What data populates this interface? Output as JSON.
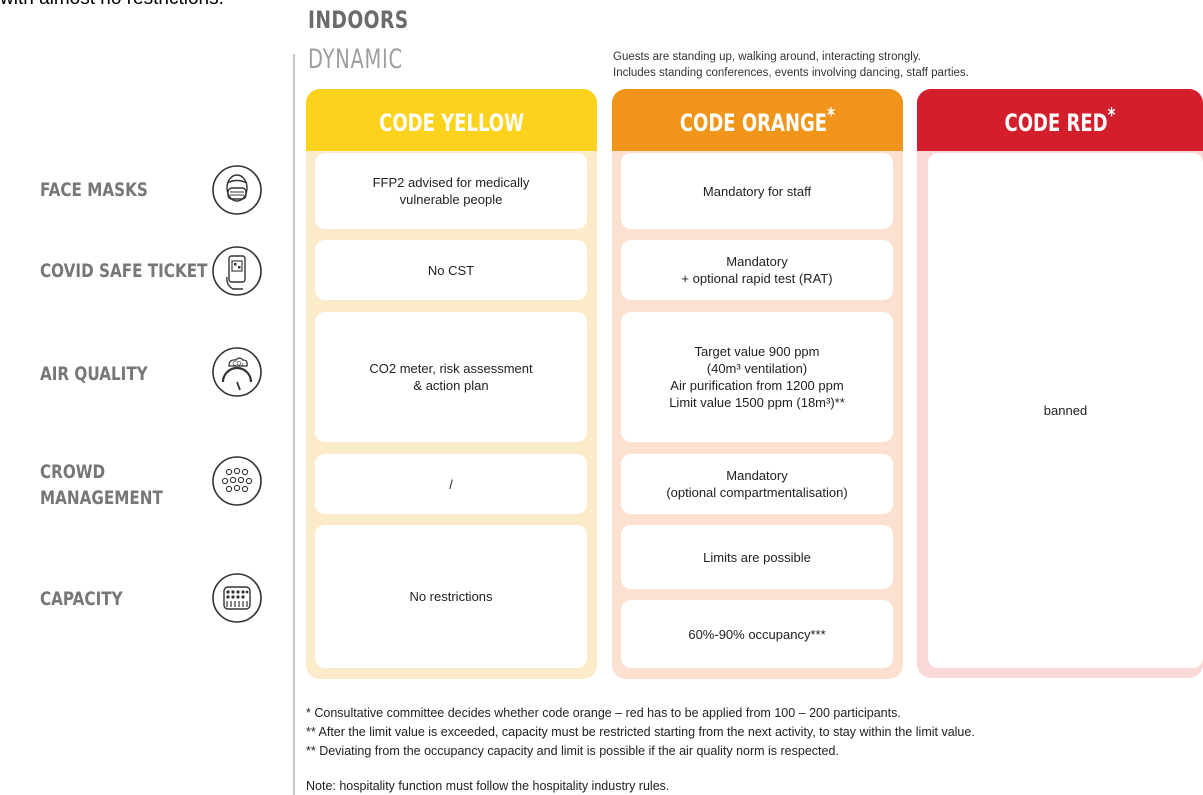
{
  "header_cut": "with almost no restrictions.",
  "title": {
    "line1": "INDOORS",
    "line2": "DYNAMIC"
  },
  "description": [
    "Guests are standing up, walking around, interacting strongly.",
    "Includes standing conferences, events involving dancing, staff parties."
  ],
  "columns": [
    {
      "label": "CODE YELLOW",
      "asterisk": "",
      "color": "#fcd21c"
    },
    {
      "label": "CODE ORANGE",
      "asterisk": "*",
      "color": "#f0941a"
    },
    {
      "label": "CODE RED",
      "asterisk": "*",
      "color": "#d31f2b"
    }
  ],
  "rows": [
    {
      "label_lines": [
        "FACE MASKS"
      ],
      "icon": "face-mask-icon"
    },
    {
      "label_lines": [
        "COVID SAFE TICKET"
      ],
      "icon": "phone-qr-icon"
    },
    {
      "label_lines": [
        "AIR QUALITY"
      ],
      "icon": "co2-gauge-icon"
    },
    {
      "label_lines": [
        "CROWD",
        "MANAGEMENT"
      ],
      "icon": "crowd-icon"
    },
    {
      "label_lines": [
        "CAPACITY"
      ],
      "icon": "capacity-icon"
    }
  ],
  "yellow_cells": [
    [
      "FFP2 advised for medically",
      "vulnerable people"
    ],
    [
      "No CST"
    ],
    [
      "CO2 meter, risk assessment",
      "& action plan"
    ],
    [
      "/"
    ],
    [
      "No restrictions"
    ]
  ],
  "orange_cells": [
    [
      "Mandatory for staff"
    ],
    [
      "Mandatory",
      "+ optional rapid test (RAT)"
    ],
    [
      "Target value 900 ppm",
      "(40m³ ventilation)",
      "Air purification from 1200 ppm",
      "Limit value 1500 ppm (18m³)**"
    ],
    [
      "Mandatory",
      "(optional compartmentalisation)"
    ],
    [
      "Limits are possible"
    ],
    [
      "60%-90% occupancy***"
    ]
  ],
  "red_cell": "banned",
  "footnotes": [
    "* Consultative committee decides whether code orange – red has to be applied from  100 – 200 participants.",
    "** After the limit value is exceeded, capacity must be restricted starting from the next activity, to stay within the limit value.",
    "** Deviating from the occupancy capacity and limit is possible if the air quality norm is respected."
  ],
  "note": "Note: hospitality function must follow the hospitality industry rules."
}
